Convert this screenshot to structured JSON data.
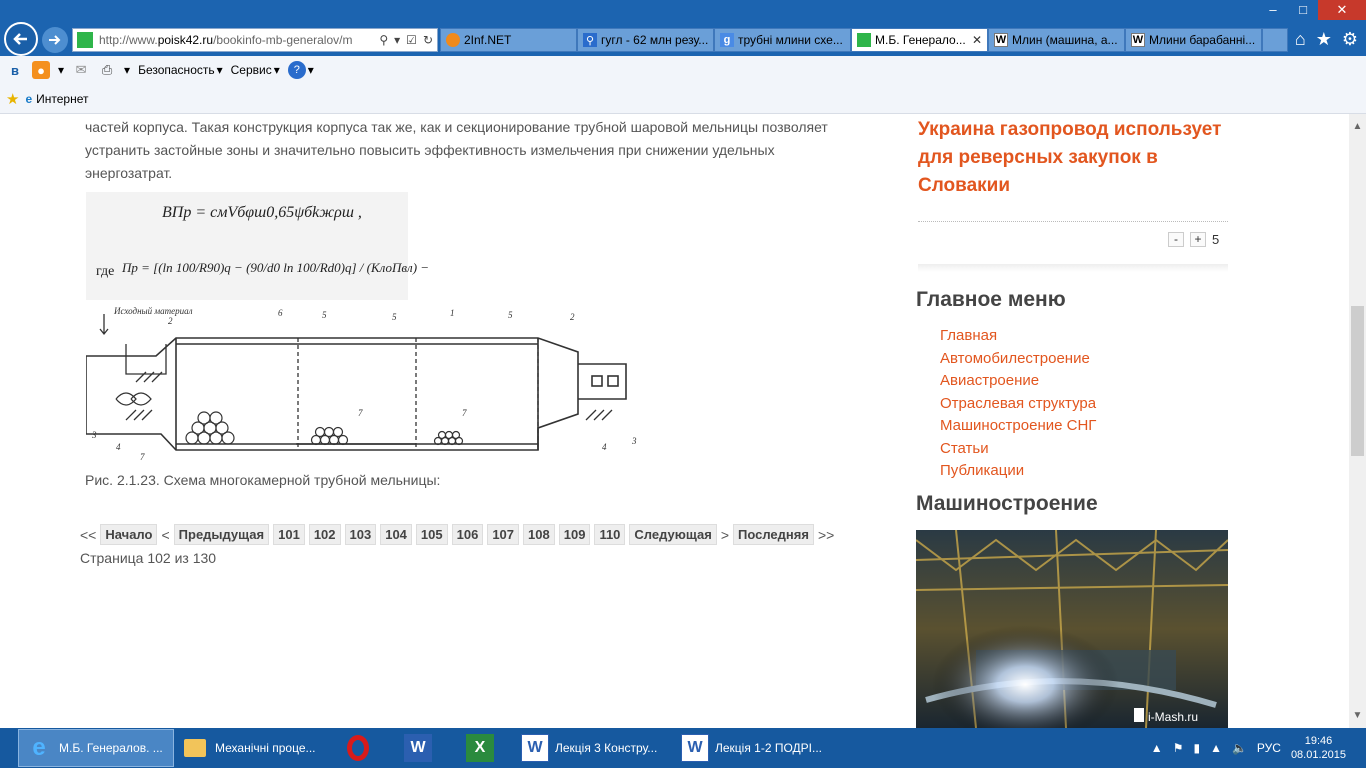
{
  "browser": {
    "url_prefix": "http://www.",
    "url_domain": "poisk42.ru",
    "url_path": "/bookinfo-mb-generalov/m",
    "tabs": [
      {
        "label": "2Inf.NET",
        "icon": "firefox-icon",
        "active": false
      },
      {
        "label": "гугл - 62 млн резу...",
        "icon": "search-icon",
        "active": false
      },
      {
        "label": "трубні млини схе...",
        "icon": "google-icon",
        "active": false
      },
      {
        "label": "М.Б. Генерало...",
        "icon": "green-square-icon",
        "active": true
      },
      {
        "label": "Млин (машина, а...",
        "icon": "wikipedia-icon",
        "active": false
      },
      {
        "label": "Млини барабанні...",
        "icon": "wikipedia-icon",
        "active": false
      }
    ],
    "command_bar": {
      "safety": "Безопасность",
      "service": "Сервис"
    },
    "favorites": {
      "internet": "Интернет"
    }
  },
  "article": {
    "paragraph": "частей корпуса. Такая конструкция корпуса так же, как и секционирование трубной шаровой мельницы позволяет устранить застойные зоны и значительно повысить эффективность измельчения при снижении удельных энергозатрат.",
    "formula_line1": "ВПр = cмVбφш0,65ψбkжρш ,",
    "formula_where": "где",
    "formula_line2": "Пр = [(ln 100/R90)q − (90/d0 ln 100/Rd0)q] / (KлоПвл) −",
    "diagram_labels": {
      "material": "Исходный материал",
      "n1": "1",
      "n2": "2",
      "n3": "3",
      "n4": "4",
      "n5": "5",
      "n6": "6",
      "n7": "7"
    },
    "caption": "Рис. 2.1.23. Схема многокамерной трубной мельницы:"
  },
  "pagination": {
    "first_marker": "<<",
    "first": "Начало",
    "prev_marker": "<",
    "prev": "Предыдущая",
    "pages": [
      "101",
      "102",
      "103",
      "104",
      "105",
      "106",
      "107",
      "108",
      "109",
      "110"
    ],
    "next": "Следующая",
    "next_marker": ">",
    "last": "Последняя",
    "last_marker": ">>",
    "info": "Страница 102 из 130"
  },
  "sidebar": {
    "news_title": "Украина газопровод использует для реверсных закупок в Словакии",
    "vote_minus": "-",
    "vote_plus": "+",
    "vote_count": "5",
    "menu_title": "Главное меню",
    "menu_items": [
      "Главная",
      "Автомобилестроение",
      "Авиастроение",
      "Отраслевая структура",
      "Машиностроение СНГ",
      "Статьи",
      "Публикации"
    ],
    "mash_title": "Машиностроение",
    "mash_watermark": "i-Mash.ru"
  },
  "taskbar": {
    "items": [
      {
        "label": "М.Б. Генералов. ...",
        "icon": "ie-icon",
        "active": true
      },
      {
        "label": "Механічні проце...",
        "icon": "folder-icon",
        "active": false
      },
      {
        "label": "",
        "icon": "opera-icon",
        "active": false
      },
      {
        "label": "",
        "icon": "word-icon",
        "active": false
      },
      {
        "label": "",
        "icon": "excel-icon",
        "active": false
      },
      {
        "label": "Лекція 3 Констру...",
        "icon": "word-doc-icon",
        "active": false
      },
      {
        "label": "Лекція 1-2 ПОДРІ...",
        "icon": "word-doc-icon",
        "active": false
      }
    ],
    "lang": "РУС",
    "time": "19:46",
    "date": "08.01.2015"
  },
  "colors": {
    "chrome_blue": "#1c64b0",
    "accent_orange": "#e2561f",
    "taskbar": "#16599f"
  }
}
